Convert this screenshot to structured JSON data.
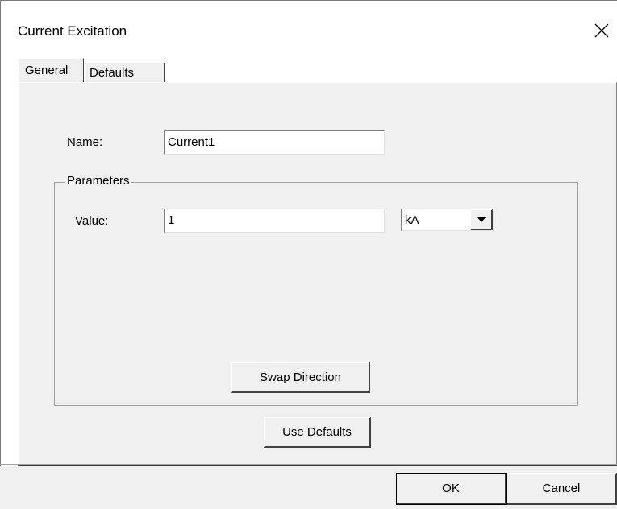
{
  "window": {
    "title": "Current Excitation",
    "close_icon": "close-icon"
  },
  "tabs": [
    {
      "label": "General",
      "active": true
    },
    {
      "label": "Defaults",
      "active": false
    }
  ],
  "form": {
    "name_label": "Name:",
    "name_value": "Current1",
    "parameters_group_label": "Parameters",
    "value_label": "Value:",
    "value_value": "1",
    "unit_selected": "kA",
    "swap_direction_label": "Swap Direction",
    "use_defaults_label": "Use Defaults"
  },
  "footer": {
    "ok_label": "OK",
    "cancel_label": "Cancel"
  }
}
